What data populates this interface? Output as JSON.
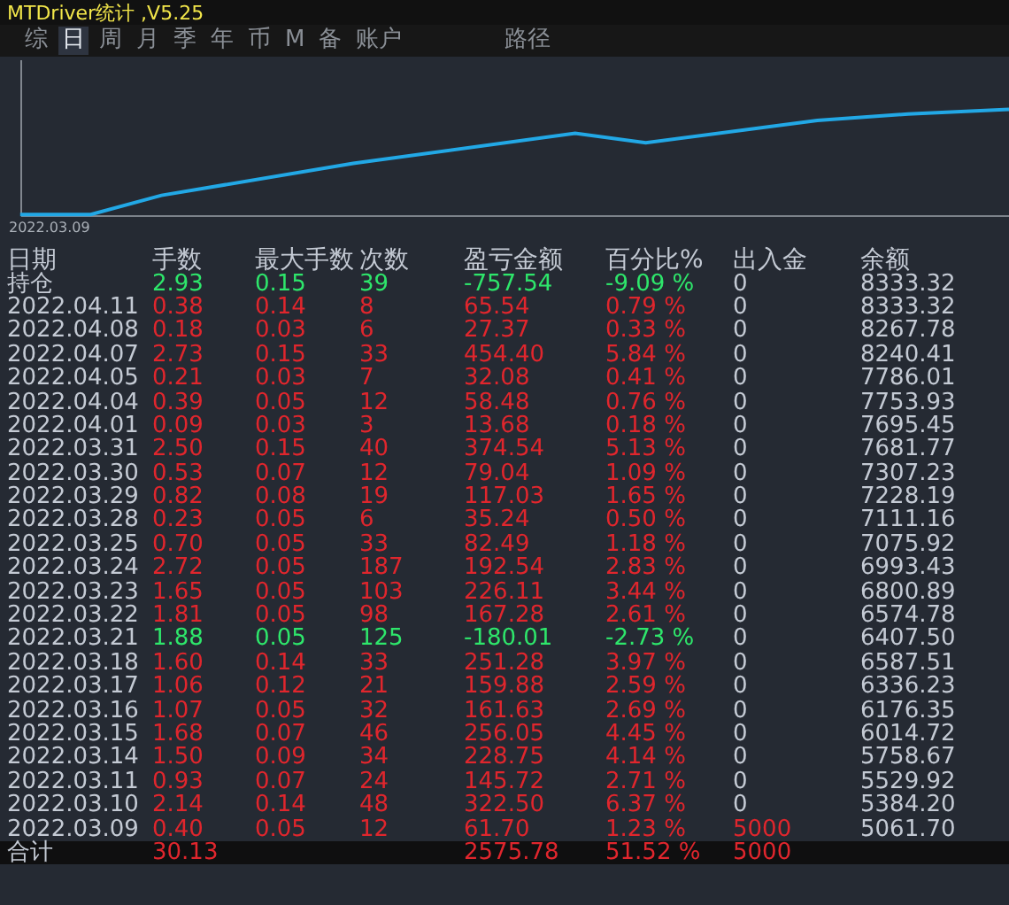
{
  "window": {
    "title": "MTDriver统计 ,V5.25"
  },
  "tabs": [
    {
      "label": "综",
      "selected": false
    },
    {
      "label": "日",
      "selected": true
    },
    {
      "label": "周",
      "selected": false
    },
    {
      "label": "月",
      "selected": false
    },
    {
      "label": "季",
      "selected": false
    },
    {
      "label": "年",
      "selected": false
    },
    {
      "label": "币",
      "selected": false
    },
    {
      "label": "M",
      "selected": false
    },
    {
      "label": "备",
      "selected": false
    },
    {
      "label": "账户",
      "selected": false
    },
    {
      "label": "路径",
      "selected": false
    }
  ],
  "chart": {
    "start_label": "2022.03.09"
  },
  "table": {
    "columns": [
      "日期",
      "手数",
      "最大手数",
      "次数",
      "盈亏金额",
      "百分比%",
      "出入金",
      "余额"
    ],
    "rows": [
      {
        "color": "#2ee66b",
        "deposit_highlighted": false,
        "cells": [
          "持仓",
          "2.93",
          "0.15",
          "39",
          "-757.54",
          "-9.09 %",
          "0",
          "8333.32"
        ]
      },
      {
        "color": "#e0262d",
        "deposit_highlighted": false,
        "cells": [
          "2022.04.11",
          "0.38",
          "0.14",
          "8",
          "65.54",
          "0.79 %",
          "0",
          "8333.32"
        ]
      },
      {
        "color": "#e0262d",
        "deposit_highlighted": false,
        "cells": [
          "2022.04.08",
          "0.18",
          "0.03",
          "6",
          "27.37",
          "0.33 %",
          "0",
          "8267.78"
        ]
      },
      {
        "color": "#e0262d",
        "deposit_highlighted": false,
        "cells": [
          "2022.04.07",
          "2.73",
          "0.15",
          "33",
          "454.40",
          "5.84 %",
          "0",
          "8240.41"
        ]
      },
      {
        "color": "#e0262d",
        "deposit_highlighted": false,
        "cells": [
          "2022.04.05",
          "0.21",
          "0.03",
          "7",
          "32.08",
          "0.41 %",
          "0",
          "7786.01"
        ]
      },
      {
        "color": "#e0262d",
        "deposit_highlighted": false,
        "cells": [
          "2022.04.04",
          "0.39",
          "0.05",
          "12",
          "58.48",
          "0.76 %",
          "0",
          "7753.93"
        ]
      },
      {
        "color": "#e0262d",
        "deposit_highlighted": false,
        "cells": [
          "2022.04.01",
          "0.09",
          "0.03",
          "3",
          "13.68",
          "0.18 %",
          "0",
          "7695.45"
        ]
      },
      {
        "color": "#e0262d",
        "deposit_highlighted": false,
        "cells": [
          "2022.03.31",
          "2.50",
          "0.15",
          "40",
          "374.54",
          "5.13 %",
          "0",
          "7681.77"
        ]
      },
      {
        "color": "#e0262d",
        "deposit_highlighted": false,
        "cells": [
          "2022.03.30",
          "0.53",
          "0.07",
          "12",
          "79.04",
          "1.09 %",
          "0",
          "7307.23"
        ]
      },
      {
        "color": "#e0262d",
        "deposit_highlighted": false,
        "cells": [
          "2022.03.29",
          "0.82",
          "0.08",
          "19",
          "117.03",
          "1.65 %",
          "0",
          "7228.19"
        ]
      },
      {
        "color": "#e0262d",
        "deposit_highlighted": false,
        "cells": [
          "2022.03.28",
          "0.23",
          "0.05",
          "6",
          "35.24",
          "0.50 %",
          "0",
          "7111.16"
        ]
      },
      {
        "color": "#e0262d",
        "deposit_highlighted": false,
        "cells": [
          "2022.03.25",
          "0.70",
          "0.05",
          "33",
          "82.49",
          "1.18 %",
          "0",
          "7075.92"
        ]
      },
      {
        "color": "#e0262d",
        "deposit_highlighted": false,
        "cells": [
          "2022.03.24",
          "2.72",
          "0.05",
          "187",
          "192.54",
          "2.83 %",
          "0",
          "6993.43"
        ]
      },
      {
        "color": "#e0262d",
        "deposit_highlighted": false,
        "cells": [
          "2022.03.23",
          "1.65",
          "0.05",
          "103",
          "226.11",
          "3.44 %",
          "0",
          "6800.89"
        ]
      },
      {
        "color": "#e0262d",
        "deposit_highlighted": false,
        "cells": [
          "2022.03.22",
          "1.81",
          "0.05",
          "98",
          "167.28",
          "2.61 %",
          "0",
          "6574.78"
        ]
      },
      {
        "color": "#2ee66b",
        "deposit_highlighted": false,
        "cells": [
          "2022.03.21",
          "1.88",
          "0.05",
          "125",
          "-180.01",
          "-2.73 %",
          "0",
          "6407.50"
        ]
      },
      {
        "color": "#e0262d",
        "deposit_highlighted": false,
        "cells": [
          "2022.03.18",
          "1.60",
          "0.14",
          "33",
          "251.28",
          "3.97 %",
          "0",
          "6587.51"
        ]
      },
      {
        "color": "#e0262d",
        "deposit_highlighted": false,
        "cells": [
          "2022.03.17",
          "1.06",
          "0.12",
          "21",
          "159.88",
          "2.59 %",
          "0",
          "6336.23"
        ]
      },
      {
        "color": "#e0262d",
        "deposit_highlighted": false,
        "cells": [
          "2022.03.16",
          "1.07",
          "0.05",
          "32",
          "161.63",
          "2.69 %",
          "0",
          "6176.35"
        ]
      },
      {
        "color": "#e0262d",
        "deposit_highlighted": false,
        "cells": [
          "2022.03.15",
          "1.68",
          "0.07",
          "46",
          "256.05",
          "4.45 %",
          "0",
          "6014.72"
        ]
      },
      {
        "color": "#e0262d",
        "deposit_highlighted": false,
        "cells": [
          "2022.03.14",
          "1.50",
          "0.09",
          "34",
          "228.75",
          "4.14 %",
          "0",
          "5758.67"
        ]
      },
      {
        "color": "#e0262d",
        "deposit_highlighted": false,
        "cells": [
          "2022.03.11",
          "0.93",
          "0.07",
          "24",
          "145.72",
          "2.71 %",
          "0",
          "5529.92"
        ]
      },
      {
        "color": "#e0262d",
        "deposit_highlighted": false,
        "cells": [
          "2022.03.10",
          "2.14",
          "0.14",
          "48",
          "322.50",
          "6.37 %",
          "0",
          "5384.20"
        ]
      },
      {
        "color": "#e0262d",
        "deposit_highlighted": true,
        "cells": [
          "2022.03.09",
          "0.40",
          "0.05",
          "12",
          "61.70",
          "1.23 %",
          "5000",
          "5061.70"
        ]
      }
    ],
    "total": {
      "cells": [
        "合计",
        "30.13",
        "",
        "",
        "2575.78",
        "51.52 %",
        "5000",
        ""
      ]
    }
  }
}
